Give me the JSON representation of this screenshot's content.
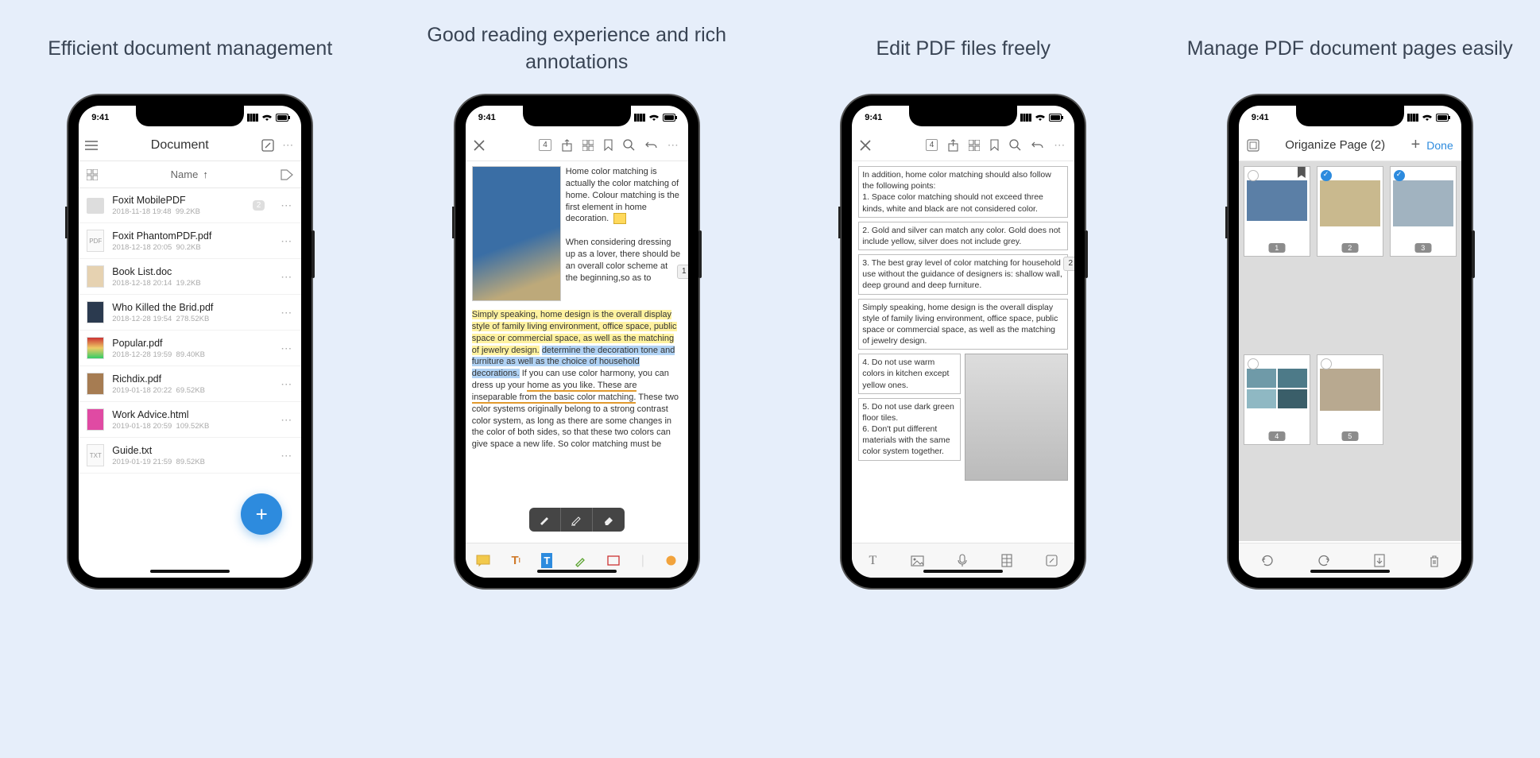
{
  "status_time": "9:41",
  "panel1": {
    "caption": "Efficient document management",
    "nav_title": "Document",
    "column_header": "Name",
    "fab": "+",
    "files": [
      {
        "name": "Foxit MobilePDF",
        "date": "2018-11-18 19:48",
        "size": "99.2KB",
        "folder": true,
        "badge": "2"
      },
      {
        "name": "Foxit PhantomPDF.pdf",
        "date": "2018-12-18 20:05",
        "size": "90.2KB"
      },
      {
        "name": "Book List.doc",
        "date": "2018-12-18 20:14",
        "size": "19.2KB"
      },
      {
        "name": "Who Killed the Brid.pdf",
        "date": "2018-12-28 19:54",
        "size": "278.52KB"
      },
      {
        "name": "Popular.pdf",
        "date": "2018-12-28 19:59",
        "size": "89.40KB"
      },
      {
        "name": "Richdix.pdf",
        "date": "2019-01-18 20:22",
        "size": "69.52KB"
      },
      {
        "name": "Work Advice.html",
        "date": "2019-01-18 20:59",
        "size": "109.52KB"
      },
      {
        "name": "Guide.txt",
        "date": "2019-01-19 21:59",
        "size": "89.52KB"
      }
    ]
  },
  "panel2": {
    "caption": "Good reading experience and rich annotations",
    "page_box": "4",
    "page_side": "1",
    "intro_text": "Home color matching is actually the color matching of home. Colour matching is the first element in home decoration.",
    "intro_text2": "When considering dressing up as a lover, there should be an overall color scheme at the beginning,so as to",
    "para2a": "Simply speaking, home design is the overall display style of family living environment, office space, public space or commercial space, as well as the matching of jewelry design.",
    "hl_blue": "determine the decoration tone and furniture as well as the choice of household decorations.",
    "para2b": " If you can use color harmony, you can dress up your ",
    "under": "home as you like. These are inseparable from the basic color matching.",
    "para2c": "  These two color systems originally belong to a strong contrast color system, as long as there are some changes in the color of both sides, so that these two colors can give space a new life. So color matching must be"
  },
  "panel3": {
    "caption": "Edit PDF files freely",
    "page_box": "4",
    "page_side": "2",
    "p1": "In addition, home color matching should also follow the following points:\n1. Space color matching should not exceed three kinds, white and black are not considered color.",
    "p2": "2. Gold and silver can match any color. Gold does not include yellow, silver does not include grey.",
    "p3": "3. The best gray level of color matching for household use without the guidance of designers is: shallow wall, deep ground and deep furniture.",
    "p4": "Simply speaking, home design is the overall display style of family living environment, office space, public space or commercial space, as well as the matching of jewelry design.",
    "p5": "4. Do not use warm colors in kitchen except yellow ones.",
    "p6": "5. Do not use dark green floor tiles.\n6. Don't put different materials with the same color system together."
  },
  "panel4": {
    "caption": "Manage PDF document pages easily",
    "title": "Origanize Page  (2)",
    "done": "Done",
    "pages": [
      {
        "n": "1",
        "checked": false,
        "bookmark": true
      },
      {
        "n": "2",
        "checked": true
      },
      {
        "n": "3",
        "checked": true
      },
      {
        "n": "4",
        "checked": false
      },
      {
        "n": "5",
        "checked": false
      }
    ]
  }
}
